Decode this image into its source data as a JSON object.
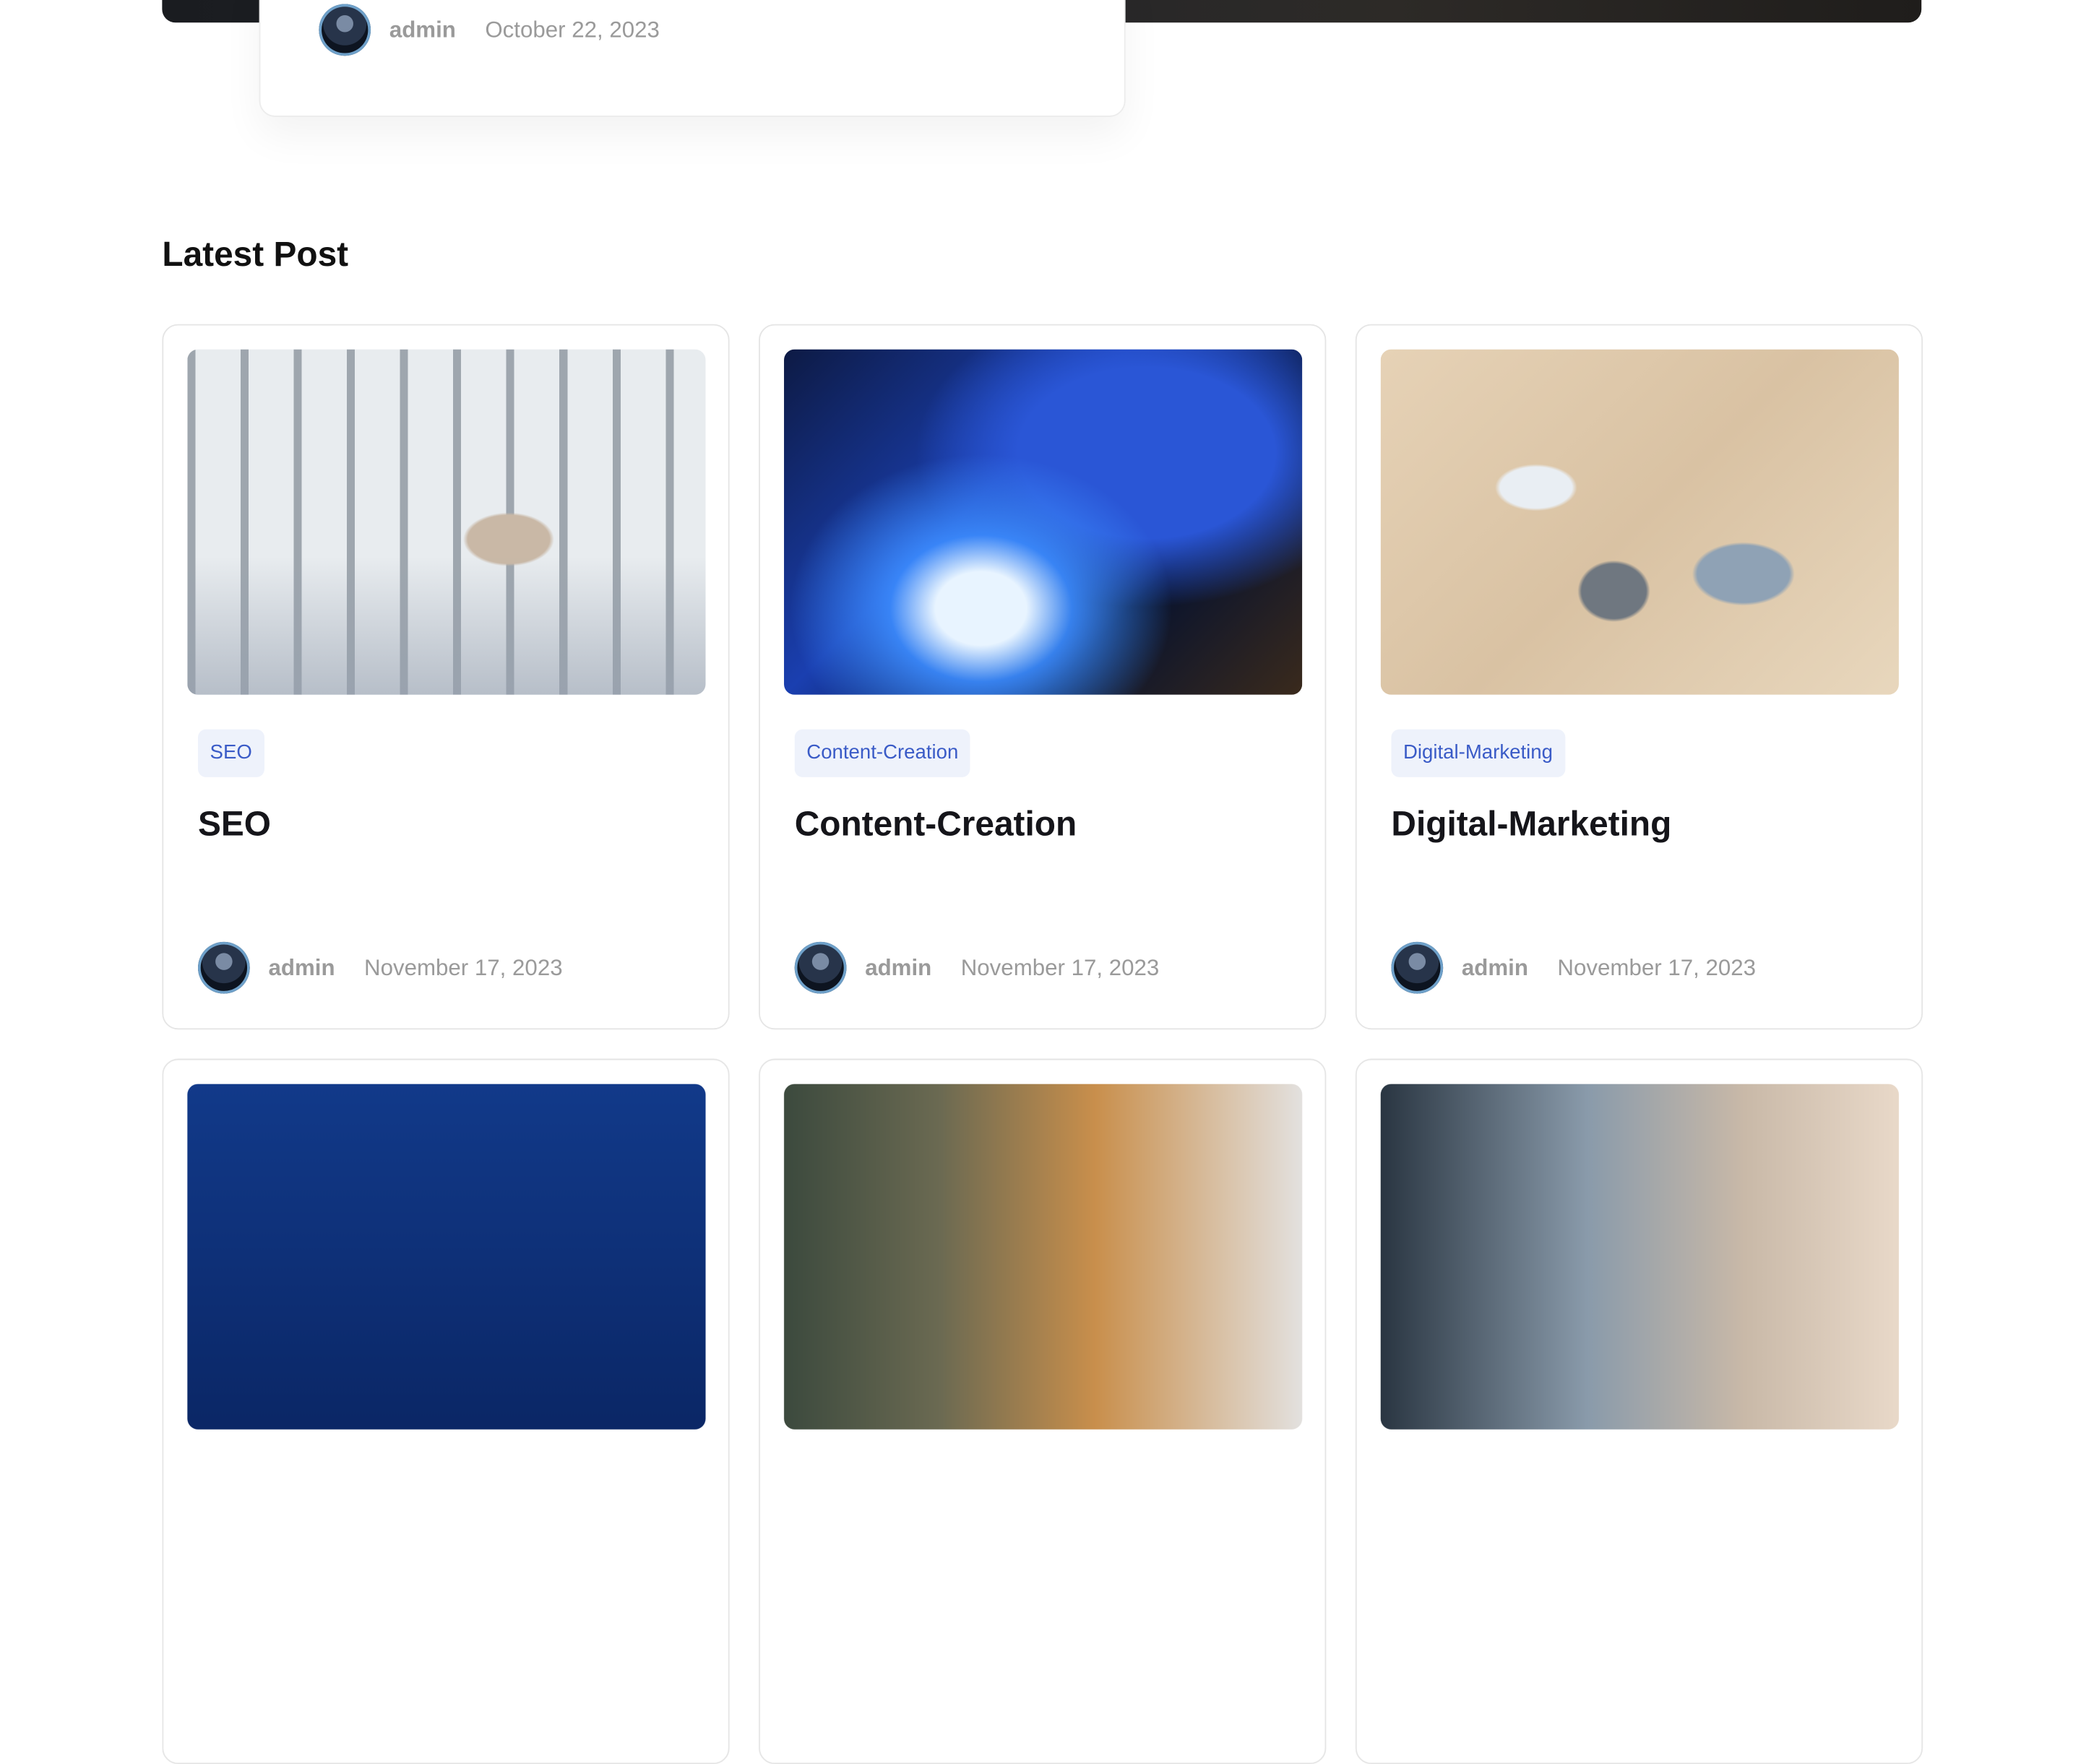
{
  "featured": {
    "author": "admin",
    "date": "October 22, 2023"
  },
  "section": {
    "title": "Latest Post"
  },
  "posts": [
    {
      "tag": "SEO",
      "title": "SEO",
      "author": "admin",
      "date": "November 17, 2023"
    },
    {
      "tag": "Content-Creation",
      "title": "Content-Creation",
      "author": "admin",
      "date": "November 17, 2023"
    },
    {
      "tag": "Digital-Marketing",
      "title": "Digital-Marketing",
      "author": "admin",
      "date": "November 17, 2023"
    }
  ],
  "colors": {
    "tag_text": "#3a5bc7",
    "tag_bg": "#eef2fb",
    "meta_text": "#9a9a9a",
    "title_text": "#15151a"
  }
}
